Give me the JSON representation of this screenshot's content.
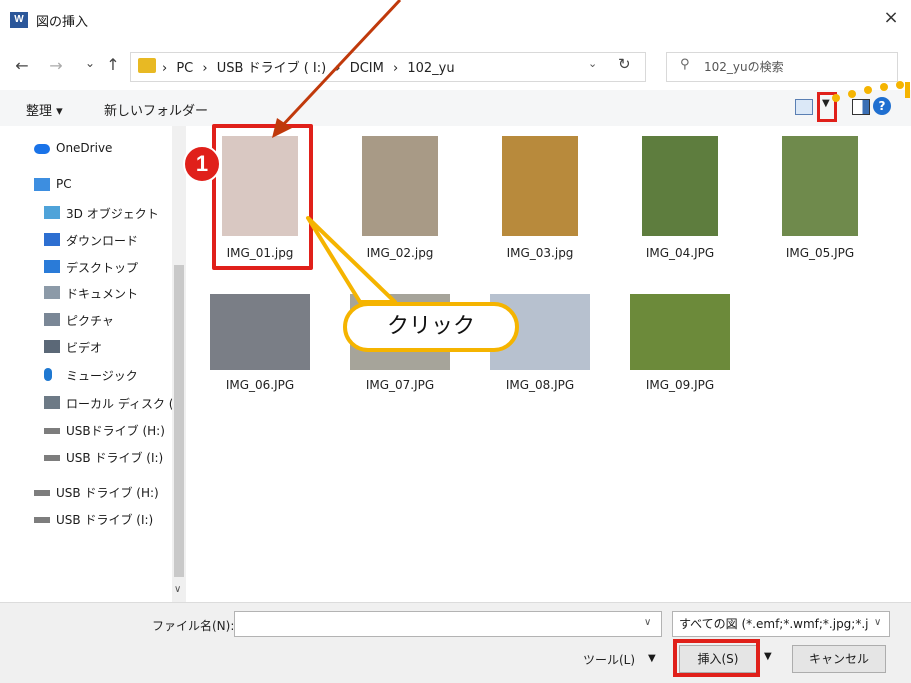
{
  "window": {
    "title": "図の挿入",
    "app_icon": "W",
    "close": "×"
  },
  "nav": {
    "back": "←",
    "forward": "→",
    "recent": "⌄",
    "up": "↑",
    "breadcrumb": [
      "›",
      "PC",
      "›",
      "USB ドライブ ( I:)",
      "›",
      "DCIM",
      "›",
      "102_yu"
    ],
    "addr_dropdown": "⌄",
    "refresh": "↻",
    "search_placeholder": "102_yuの検索"
  },
  "toolbar": {
    "organize": "整理 ▾",
    "new_folder": "新しいフォルダー",
    "help": "?"
  },
  "sidebar": {
    "items": [
      {
        "label": "OneDrive",
        "icon": "cloud-icon"
      },
      {
        "label": "PC",
        "icon": "pc-icon"
      },
      {
        "label": "3D オブジェクト",
        "icon": "cube-icon"
      },
      {
        "label": "ダウンロード",
        "icon": "download-icon"
      },
      {
        "label": "デスクトップ",
        "icon": "desktop-icon"
      },
      {
        "label": "ドキュメント",
        "icon": "document-icon"
      },
      {
        "label": "ピクチャ",
        "icon": "picture-icon"
      },
      {
        "label": "ビデオ",
        "icon": "video-icon"
      },
      {
        "label": "ミュージック",
        "icon": "music-icon"
      },
      {
        "label": "ローカル ディスク (C",
        "icon": "disk-icon"
      },
      {
        "label": "USBドライブ (H:)",
        "icon": "usb-icon"
      },
      {
        "label": "USB ドライブ (I:)",
        "icon": "usb-icon"
      },
      {
        "label": "USB ドライブ (H:)",
        "icon": "usb-icon"
      },
      {
        "label": "USB ドライブ (I:)",
        "icon": "usb-icon"
      }
    ]
  },
  "files": [
    {
      "name": "IMG_01.jpg",
      "color": "#d9c8c2"
    },
    {
      "name": "IMG_02.jpg",
      "color": "#a89a86"
    },
    {
      "name": "IMG_03.jpg",
      "color": "#b88a3c"
    },
    {
      "name": "IMG_04.JPG",
      "color": "#5e7d3e"
    },
    {
      "name": "IMG_05.JPG",
      "color": "#6f8a4c"
    },
    {
      "name": "IMG_06.JPG",
      "color": "#7a7e86"
    },
    {
      "name": "IMG_07.JPG",
      "color": "#a6a49a"
    },
    {
      "name": "IMG_08.JPG",
      "color": "#b7c1cf"
    },
    {
      "name": "IMG_09.JPG",
      "color": "#6c8a3a"
    }
  ],
  "annotations": {
    "step_badge": "1",
    "callout": "クリック"
  },
  "bottom": {
    "filename_label": "ファイル名(N):",
    "filename_value": "",
    "file_filter": "すべての図 (*.emf;*.wmf;*.jpg;*.j",
    "tools": "ツール(L)",
    "insert": "挿入(S)",
    "cancel": "キャンセル"
  },
  "colors": {
    "highlight_red": "#e0201a",
    "callout_yellow": "#f5b400",
    "arrow": "#c0390b"
  }
}
